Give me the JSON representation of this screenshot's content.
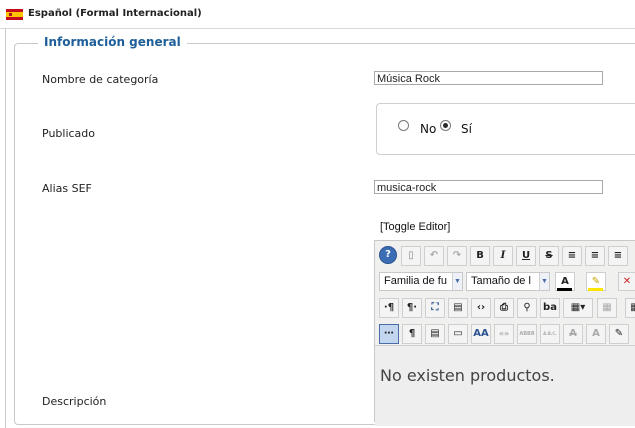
{
  "language": {
    "label": "Español (Formal Internacional)"
  },
  "section": {
    "legend": "Información general"
  },
  "fields": {
    "category_name": {
      "label": "Nombre de categoría",
      "value": "Música Rock"
    },
    "published": {
      "label": "Publicado",
      "options": [
        {
          "label": "No",
          "checked": false
        },
        {
          "label": "Sí",
          "checked": true
        }
      ]
    },
    "alias": {
      "label": "Alias SEF",
      "value": "musica-rock"
    },
    "description": {
      "label": "Descripción"
    }
  },
  "editor": {
    "toggle_label": "[Toggle Editor]",
    "toolbar_row1": [
      "help-icon",
      "new-document-icon",
      "undo-icon",
      "redo-icon",
      "bold-icon",
      "italic-icon",
      "underline-icon",
      "strikethrough-icon",
      "justify-full-icon",
      "align-center-icon",
      "align-left-icon"
    ],
    "toolbar_row1_text": {
      "bold": "B",
      "italic": "I",
      "underline": "U",
      "strikethrough": "S"
    },
    "font_family": "Familia de fu",
    "font_size": "Tamaño de l",
    "font_color_label": "A",
    "toolbar_row3_text": {
      "ltr": "·¶",
      "rtl": "¶·",
      "sub": "ba"
    },
    "toolbar_row4_text": {
      "pilcrow": "¶",
      "styles": "AA",
      "cite": "«»",
      "abbr": "ABBR",
      "acronym": "A.B.C.",
      "del": "A",
      "ins": "A"
    },
    "content": "No existen productos.",
    "colors": {
      "font": "#000000",
      "highlight": "#ffe500"
    }
  },
  "colors": {
    "legend": "#1e5f9a",
    "flag_red": "#c60b1e",
    "flag_yellow": "#ffc400"
  }
}
